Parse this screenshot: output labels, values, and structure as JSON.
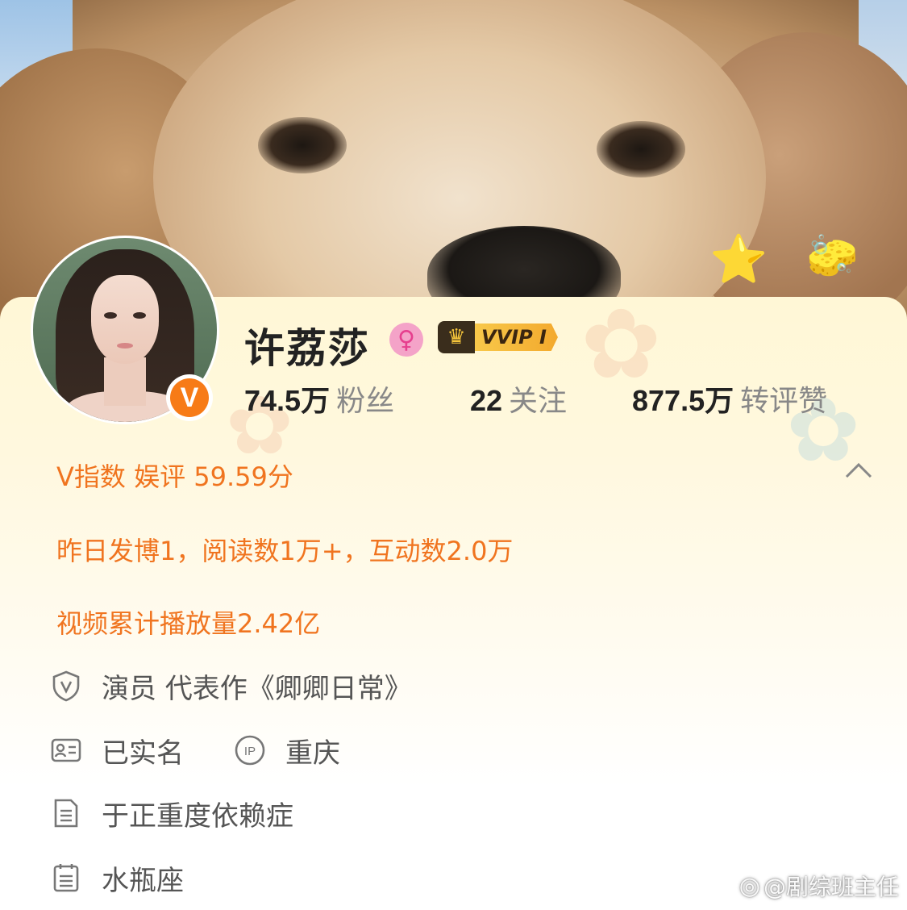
{
  "profile": {
    "name": "许荔莎",
    "vip_label": "VVIP I",
    "verified_badge": "V",
    "gender_icon": "female-icon",
    "stats": [
      {
        "value": "74.5万",
        "label": "粉丝"
      },
      {
        "value": "22",
        "label": "关注"
      },
      {
        "value": "877.5万",
        "label": "转评赞"
      }
    ]
  },
  "v_index": "V指数 娱评 59.59分",
  "activity": "昨日发博1，阅读数1万+，互动数2.0万",
  "video_plays": "视频累计播放量2.42亿",
  "info": {
    "occupation": "演员 代表作《卿卿日常》",
    "real_name": "已实名",
    "ip_location": "重庆",
    "bio": "于正重度依赖症",
    "zodiac": "水瓶座"
  },
  "watermark": "@剧综班主任",
  "colors": {
    "accent_orange": "#f0741f",
    "vip_gold": "#f8c84a",
    "verified_orange": "#f77b17"
  }
}
